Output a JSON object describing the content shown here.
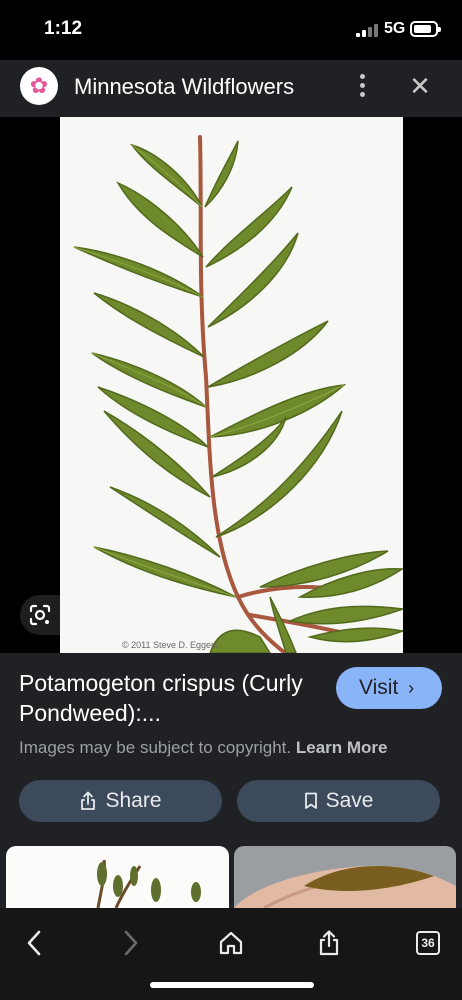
{
  "status_bar": {
    "time": "1:12",
    "network": "5G",
    "battery_level": 0.85
  },
  "header": {
    "site_name": "Minnesota Wildflowers",
    "site_icon": "pink-flower-icon",
    "menu_icon": "more-vert-icon",
    "close_icon": "close-icon"
  },
  "image": {
    "credit": "© 2011 Steve D. Eggers",
    "lens_icon": "google-lens-icon"
  },
  "result": {
    "title": "Potamogeton crispus (Curly Pondweed):...",
    "visit_label": "Visit",
    "copyright_text": "Images may be subject to copyright.",
    "learn_more": "Learn More",
    "share_label": "Share",
    "save_label": "Save"
  },
  "nav": {
    "back_icon": "back-icon",
    "forward_icon": "forward-icon",
    "home_icon": "home-icon",
    "share_icon": "share-icon",
    "tabs_count": "36"
  },
  "colors": {
    "accent": "#8ab4f8",
    "button_bg": "#3c4a5c",
    "background": "#202124"
  }
}
